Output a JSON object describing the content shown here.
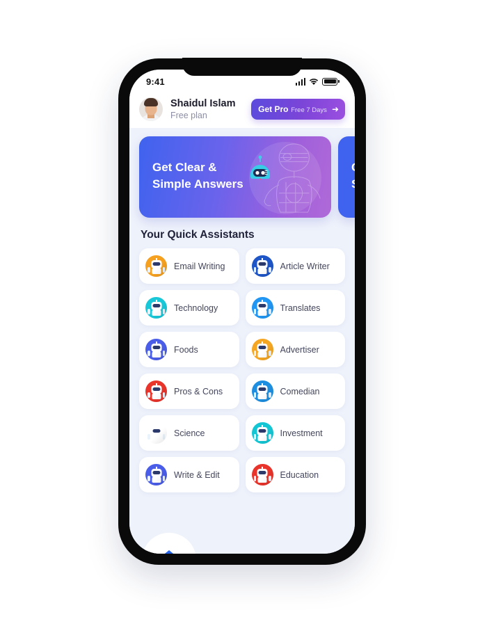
{
  "device": {
    "status_bar": {
      "time": "9:41",
      "signal_icon": "signal-bars-icon",
      "wifi_icon": "wifi-icon",
      "battery_icon": "battery-full-icon"
    }
  },
  "header": {
    "avatar_icon": "user-avatar-photo",
    "user_name": "Shaidul Islam",
    "plan_label": "Free plan",
    "get_pro": {
      "title": "Get Pro",
      "subtitle": "Free 7 Days",
      "arrow_icon": "arrow-right-icon"
    }
  },
  "banners": [
    {
      "title": "Get Clear &\nSimple Answers",
      "mascot_icon": "robot-mascot-icon"
    },
    {
      "title": "Get\nS",
      "mascot_icon": "robot-mascot-icon"
    }
  ],
  "section": {
    "title": "Your Quick Assistants"
  },
  "assistants": [
    {
      "label": "Email Writing",
      "icon": "robot-avatar-icon",
      "color": "#f5a01f"
    },
    {
      "label": "Article Writer",
      "icon": "robot-avatar-icon",
      "color": "#1e55c7"
    },
    {
      "label": "Technology",
      "icon": "robot-avatar-icon",
      "color": "#18c8d8"
    },
    {
      "label": "Translates",
      "icon": "robot-avatar-icon",
      "color": "#2196f3"
    },
    {
      "label": "Foods",
      "icon": "robot-avatar-icon",
      "color": "#4a5de8"
    },
    {
      "label": "Advertiser",
      "icon": "robot-avatar-icon",
      "color": "#f5a623"
    },
    {
      "label": "Pros & Cons",
      "icon": "robot-avatar-icon",
      "color": "#e8342b"
    },
    {
      "label": "Comedian",
      "icon": "robot-avatar-icon",
      "color": "#1e8fe0"
    },
    {
      "label": "Science",
      "icon": "robot-avatar-icon",
      "color": "#f2a battle"
    },
    {
      "label": "Investment",
      "icon": "robot-avatar-icon",
      "color": "#14c6d4"
    },
    {
      "label": "Write & Edit",
      "icon": "robot-avatar-icon",
      "color": "#4a5de8"
    },
    {
      "label": "Education",
      "icon": "robot-avatar-icon",
      "color": "#e8342b"
    }
  ],
  "bottom_nav": [
    {
      "icon": "home-icon",
      "active": true
    },
    {
      "icon": "nav-icon-2",
      "active": false
    },
    {
      "icon": "nav-icon-3",
      "active": false
    },
    {
      "icon": "nav-icon-4",
      "active": false
    }
  ],
  "colors": {
    "app_background": "#eef2fb",
    "card_background": "#ffffff",
    "accent_blue": "#2563eb",
    "banner_gradient_start": "#3f63ee",
    "banner_gradient_end": "#b06ad8",
    "pro_gradient_start": "#5b4bdd",
    "pro_gradient_end": "#9b4fe0"
  }
}
